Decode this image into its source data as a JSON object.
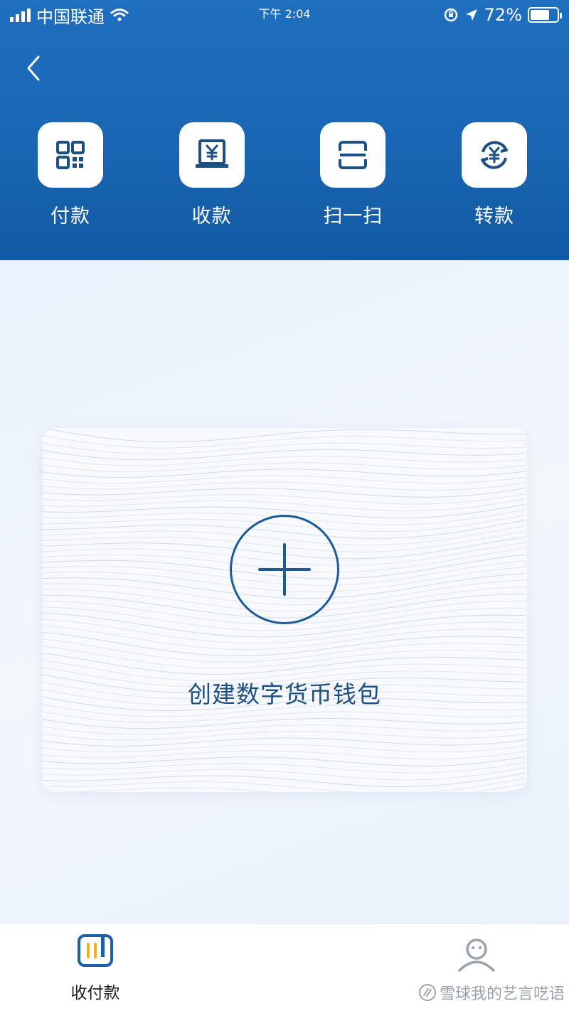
{
  "status_bar": {
    "carrier": "中国联通",
    "time": "下午 2:04",
    "battery_text": "72%",
    "battery_level": 0.72
  },
  "header": {
    "back_icon": "chevron-left-icon",
    "actions": [
      {
        "label": "付款",
        "icon": "qr-code-icon"
      },
      {
        "label": "收款",
        "icon": "receive-yuan-icon"
      },
      {
        "label": "扫一扫",
        "icon": "scan-icon"
      },
      {
        "label": "转款",
        "icon": "transfer-yuan-icon"
      }
    ]
  },
  "card": {
    "label": "创建数字货币钱包",
    "icon": "plus-icon"
  },
  "tabbar": {
    "tabs": [
      {
        "label": "收付款",
        "icon": "pay-receive-icon",
        "active": true
      },
      {
        "label": "",
        "icon": "user-icon",
        "active": false
      }
    ]
  },
  "watermark": {
    "text": "雪球我的艺言呓语"
  },
  "colors": {
    "header_blue": "#1a66b3",
    "icon_navy": "#1d4f83",
    "tab_active_blue": "#1d5ea8",
    "tab_accent_yellow": "#f2b01e",
    "tab_inactive_gray": "#9aa3ad"
  }
}
